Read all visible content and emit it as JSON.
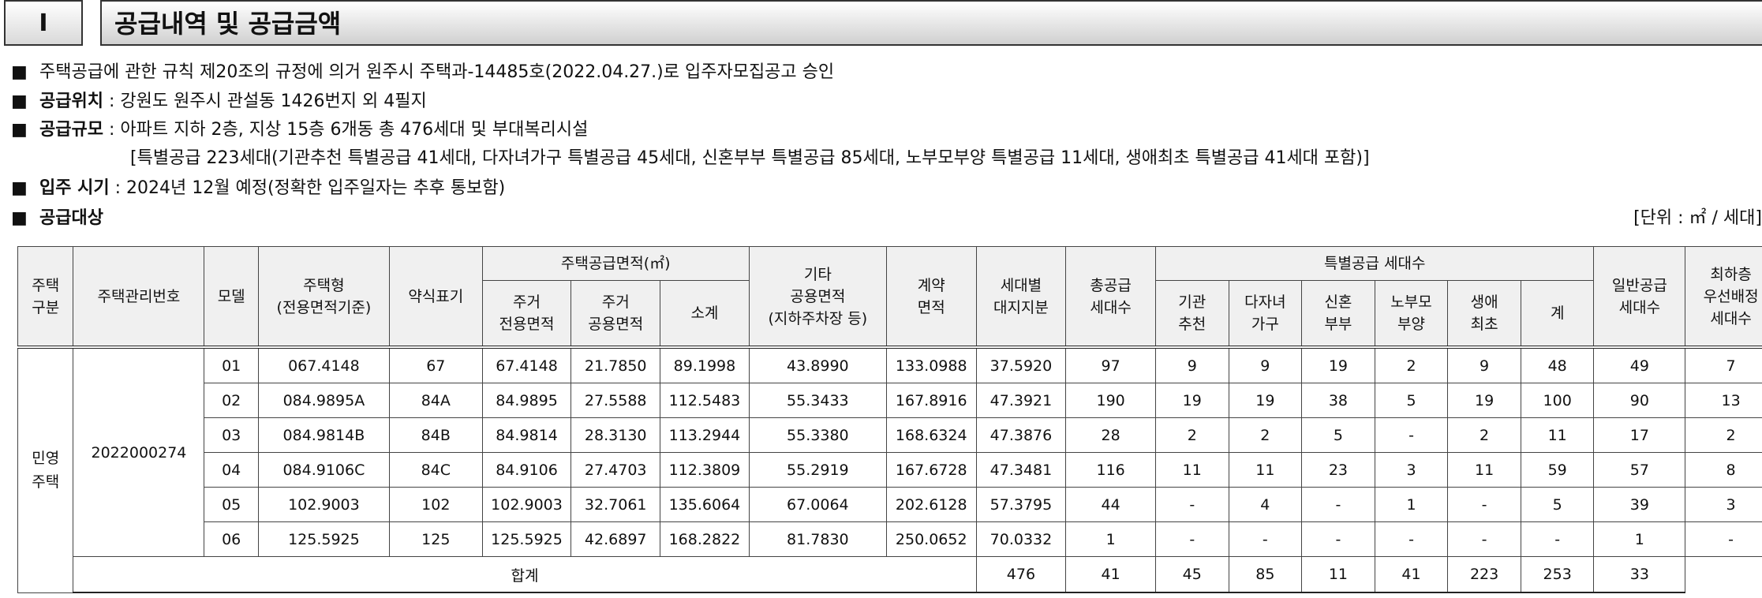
{
  "section": {
    "number": "I",
    "title": "공급내역 및 공급금액"
  },
  "bullet_symbol": "■",
  "lines": {
    "approval": "주택공급에 관한 규칙 제20조의 규정에 의거 원주시 주택과-14485호(2022.04.27.)로 입주자모집공고 승인",
    "location_label": "공급위치",
    "location_value": " : 강원도 원주시 관설동 1426번지 외 4필지",
    "scale_label": "공급규모",
    "scale_value": " : 아파트 지하 2층, 지상 15층 6개동 총 476세대 및 부대복리시설",
    "scale_detail": "[특별공급 223세대(기관추천 특별공급 41세대, 다자녀가구 특별공급 45세대, 신혼부부 특별공급 85세대, 노부모부양 특별공급 11세대, 생애최초 특별공급 41세대 포함)]",
    "movein_label": "입주 시기",
    "movein_value": " : 2024년 12월 예정(정확한 입주일자는 추후 통보함)",
    "target_label": "공급대상",
    "unit_note": "[단위 : ㎡ / 세대]"
  },
  "table": {
    "headers": {
      "housing_type": "주택\n구분",
      "mgmt_no": "주택관리번호",
      "model": "모델",
      "house_type": "주택형\n(전용면적기준)",
      "short_mark": "약식표기",
      "supply_area": "주택공급면적(㎡)",
      "private_area": "주거\n전용면적",
      "common_area": "주거\n공용면적",
      "subtotal": "소계",
      "other_common": "기타\n공용면적\n(지하주차장 등)",
      "contract_area": "계약\n면적",
      "land_share": "세대별\n대지지분",
      "total_units": "총공급\n세대수",
      "special_supply": "특별공급 세대수",
      "institution": "기관\n추천",
      "multichild": "다자녀\n가구",
      "newlywed": "신혼\n부부",
      "elderly": "노부모\n부양",
      "first_time": "생애\n최초",
      "special_sum": "계",
      "general": "일반공급\n세대수",
      "lowest_floor": "최하층\n우선배정\n세대수"
    },
    "housing_type_value": "민영\n주택",
    "mgmt_no_value": "2022000274",
    "rows": [
      [
        "01",
        "067.4148",
        "67",
        "67.4148",
        "21.7850",
        "89.1998",
        "43.8990",
        "133.0988",
        "37.5920",
        "97",
        "9",
        "9",
        "19",
        "2",
        "9",
        "48",
        "49",
        "7"
      ],
      [
        "02",
        "084.9895A",
        "84A",
        "84.9895",
        "27.5588",
        "112.5483",
        "55.3433",
        "167.8916",
        "47.3921",
        "190",
        "19",
        "19",
        "38",
        "5",
        "19",
        "100",
        "90",
        "13"
      ],
      [
        "03",
        "084.9814B",
        "84B",
        "84.9814",
        "28.3130",
        "113.2944",
        "55.3380",
        "168.6324",
        "47.3876",
        "28",
        "2",
        "2",
        "5",
        "-",
        "2",
        "11",
        "17",
        "2"
      ],
      [
        "04",
        "084.9106C",
        "84C",
        "84.9106",
        "27.4703",
        "112.3809",
        "55.2919",
        "167.6728",
        "47.3481",
        "116",
        "11",
        "11",
        "23",
        "3",
        "11",
        "59",
        "57",
        "8"
      ],
      [
        "05",
        "102.9003",
        "102",
        "102.9003",
        "32.7061",
        "135.6064",
        "67.0064",
        "202.6128",
        "57.3795",
        "44",
        "-",
        "4",
        "-",
        "1",
        "-",
        "5",
        "39",
        "3"
      ],
      [
        "06",
        "125.5925",
        "125",
        "125.5925",
        "42.6897",
        "168.2822",
        "81.7830",
        "250.0652",
        "70.0332",
        "1",
        "-",
        "-",
        "-",
        "-",
        "-",
        "-",
        "1",
        "-"
      ]
    ],
    "total_label": "합계",
    "total_values": [
      "476",
      "41",
      "45",
      "85",
      "11",
      "41",
      "223",
      "253",
      "33"
    ]
  }
}
